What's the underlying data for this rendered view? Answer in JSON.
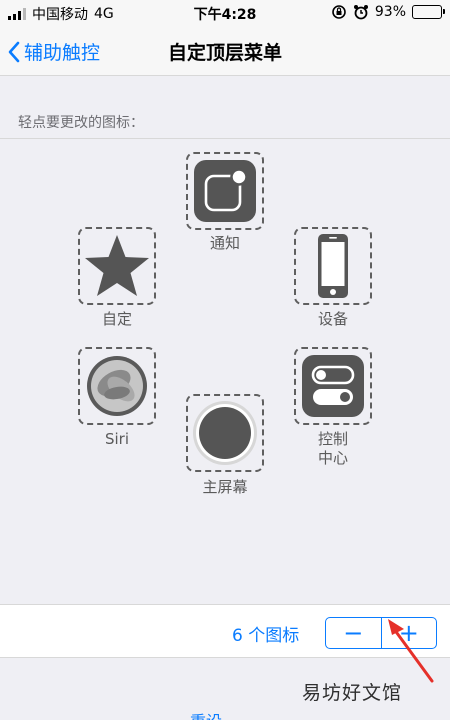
{
  "status_bar": {
    "carrier": "中国移动",
    "network": "4G",
    "time": "下午4:28",
    "battery": "93%",
    "battery_level": 0.93
  },
  "nav": {
    "back_label": "辅助触控",
    "title": "自定顶层菜单"
  },
  "section_label": "轻点要更改的图标：",
  "icons": {
    "notification": "通知",
    "device": "设备",
    "custom": "自定",
    "siri": "Siri",
    "home": "主屏幕",
    "control_line1": "控制",
    "control_line2": "中心"
  },
  "count": {
    "label": "6 个图标",
    "minus": "−",
    "plus": "+"
  },
  "watermark": "易坊好文馆",
  "bottom_text": "重设",
  "colors": {
    "accent": "#0a7cff",
    "arrow": "#e5302a"
  }
}
